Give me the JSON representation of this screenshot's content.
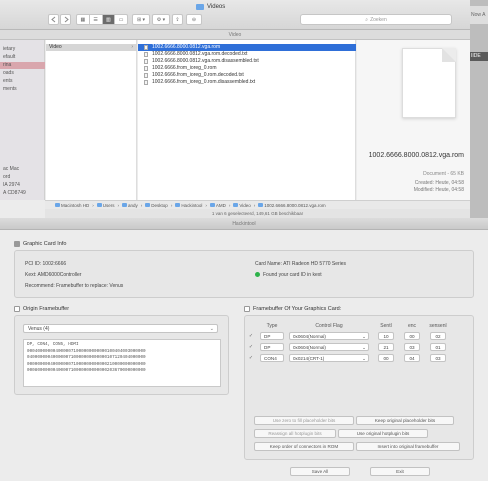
{
  "finder": {
    "window_title": "Videos",
    "path_label": "Video",
    "view_modes": [
      "▦",
      "☰",
      "▥",
      "▭"
    ],
    "toolbar_icons": [
      "⊞ ▾",
      "⚙ ▾",
      "⇪",
      "⊖"
    ],
    "search_placeholder": "Zoeken",
    "sidebar": [
      "ietary",
      "efault",
      "rina",
      "oads",
      "ents",
      "ments",
      "",
      "",
      "",
      "",
      "",
      "",
      "",
      "",
      "",
      "ac Mac",
      "ord",
      "IA 2974",
      "A CD8749"
    ],
    "column1_selected": "Video",
    "files": [
      "1002.6666.8000.0812.vga.rom",
      "1002.6666.8000.0812.vga.rom.decoded.txt",
      "1002.6666.8000.0812.vga.rom.disassembled.txt",
      "1002.6666.from_ioreg_0.rom",
      "1002.6666.from_ioreg_0.rom.decoded.txt",
      "1002.6666.from_ioreg_0.rom.disassembled.txt"
    ],
    "selected_index": 0,
    "preview_name": "1002.6666.8000.0812.vga.rom",
    "preview_kind": "Document - 65 KB",
    "preview_meta": [
      "Created: Heute, 04:58",
      "Modified: Heute, 04:58"
    ],
    "breadcrumbs": [
      "Macintosh HD",
      "Users",
      "andy",
      "Desktop",
      "Hackintool",
      "AMD",
      "Video",
      "1002.6666.8000.0812.vga.rom"
    ],
    "status": "1 van 6 geselecteerd, 149,61 GB beschikbaar",
    "right_edge": [
      "Now A",
      "IIDE"
    ]
  },
  "app": {
    "title": "Hackintool",
    "graphics_info_title": "Graphic Card Info",
    "pci_id": "PCI ID: 1002:6666",
    "kext": "Kext: AMD6000Controller",
    "recommend": "Recommend: Framebuffer to replace: Venus",
    "card_name": "Card Name: ATI Radeon HD 5770 Series",
    "found_text": "Found your card ID in kext",
    "origin_title": "Origin Framebuffer",
    "origin_selected": "Venus (4)",
    "origin_text": [
      "DP, CON4, CON5, HDMI",
      "0004000000040000071000000000000100404003000000",
      "0400000004000000710000000000000107120404000000",
      "0000000004000000071000000000000210000000000000",
      "0008000000040000710000000000000203670000000000"
    ],
    "fb_title": "Framebuffer Of Your Graphics Card:",
    "table_headers": [
      "Type",
      "Control Flag",
      "Sentl",
      "enc",
      "sensenl"
    ],
    "rows": [
      {
        "type": "DP",
        "flag": "0x0604(Normal)",
        "sentl": "10",
        "enc": "00",
        "sense": "02"
      },
      {
        "type": "DP",
        "flag": "0x0604(Normal)",
        "sentl": "21",
        "enc": "03",
        "sense": "01"
      },
      {
        "type": "CON4",
        "flag": "0x0214(CRT-1)",
        "sentl": "00",
        "enc": "04",
        "sense": "03"
      }
    ],
    "buttons": [
      "Use zero to fill placeholder bits",
      "Keep original placeholder bits",
      "Reassign all hotplugin bits",
      "Use original hotplugin bits",
      "Keep order of connectors in ROM",
      "Insert into original framebuffer"
    ],
    "save_label": "Save All",
    "exit_label": "Exit"
  },
  "colors": {
    "selection": "#2f6fd8",
    "sidebar_selected": "#d9a6ad",
    "found": "#2db34a"
  }
}
